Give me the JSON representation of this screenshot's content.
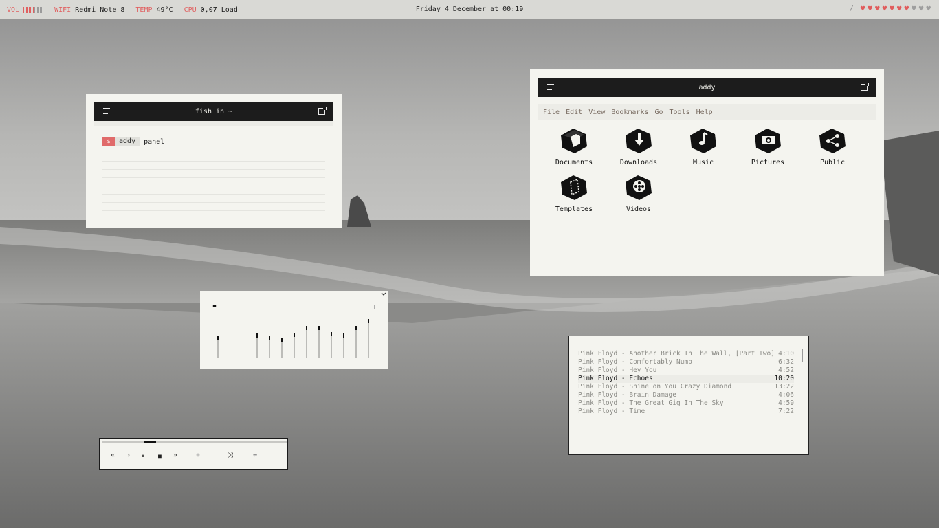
{
  "topbar": {
    "vol_label": "VOL",
    "volume_fraction": 0.55,
    "wifi_label": "WIFI",
    "wifi_value": "Redmi Note 8",
    "temp_label": "TEMP",
    "temp_value": "49°C",
    "cpu_label": "CPU",
    "cpu_value": "0,07 Load",
    "clock": "Friday 4 December at 00:19",
    "separator": "/",
    "hearts_total": 10,
    "hearts_filled": 7,
    "accent_color": "#e06060"
  },
  "terminal": {
    "title": "fish in ~",
    "prompt_symbol": "$",
    "user": "addy",
    "command": "panel"
  },
  "file_manager": {
    "title": "addy",
    "menu": [
      "File",
      "Edit",
      "View",
      "Bookmarks",
      "Go",
      "Tools",
      "Help"
    ],
    "folders": [
      {
        "label": "Documents",
        "icon": "document-folder-icon"
      },
      {
        "label": "Downloads",
        "icon": "download-folder-icon"
      },
      {
        "label": "Music",
        "icon": "music-folder-icon"
      },
      {
        "label": "Pictures",
        "icon": "camera-folder-icon"
      },
      {
        "label": "Public",
        "icon": "share-folder-icon"
      },
      {
        "label": "Templates",
        "icon": "template-folder-icon"
      },
      {
        "label": "Videos",
        "icon": "film-reel-folder-icon"
      }
    ]
  },
  "equalizer": {
    "add_symbol": "+",
    "preamp_level": 0.5,
    "band_levels": [
      0.6,
      0.55,
      0.48,
      0.62,
      0.78,
      0.78,
      0.63,
      0.6,
      0.78,
      0.95
    ]
  },
  "player": {
    "prev_symbol": "«",
    "play_symbol": "›",
    "pause_symbol": "⏸",
    "stop_symbol": "■",
    "next_symbol": "»",
    "add_symbol": "+",
    "shuffle_symbol": "⤨",
    "repeat_symbol": "⇌",
    "progress_fraction": 0.25
  },
  "playlist": {
    "tracks": [
      {
        "title": "Pink Floyd - Another Brick In The Wall, [Part Two]",
        "duration": "4:10"
      },
      {
        "title": "Pink Floyd - Comfortably Numb",
        "duration": "6:32"
      },
      {
        "title": "Pink Floyd - Hey You",
        "duration": "4:52"
      },
      {
        "title": "Pink Floyd - Echoes",
        "duration": "10:20",
        "current": true
      },
      {
        "title": "Pink Floyd - Shine on You Crazy Diamond",
        "duration": "13:22"
      },
      {
        "title": "Pink Floyd - Brain Damage",
        "duration": "4:06"
      },
      {
        "title": "Pink Floyd - The Great Gig In The Sky",
        "duration": "4:59"
      },
      {
        "title": "Pink Floyd - Time",
        "duration": "7:22"
      }
    ]
  }
}
